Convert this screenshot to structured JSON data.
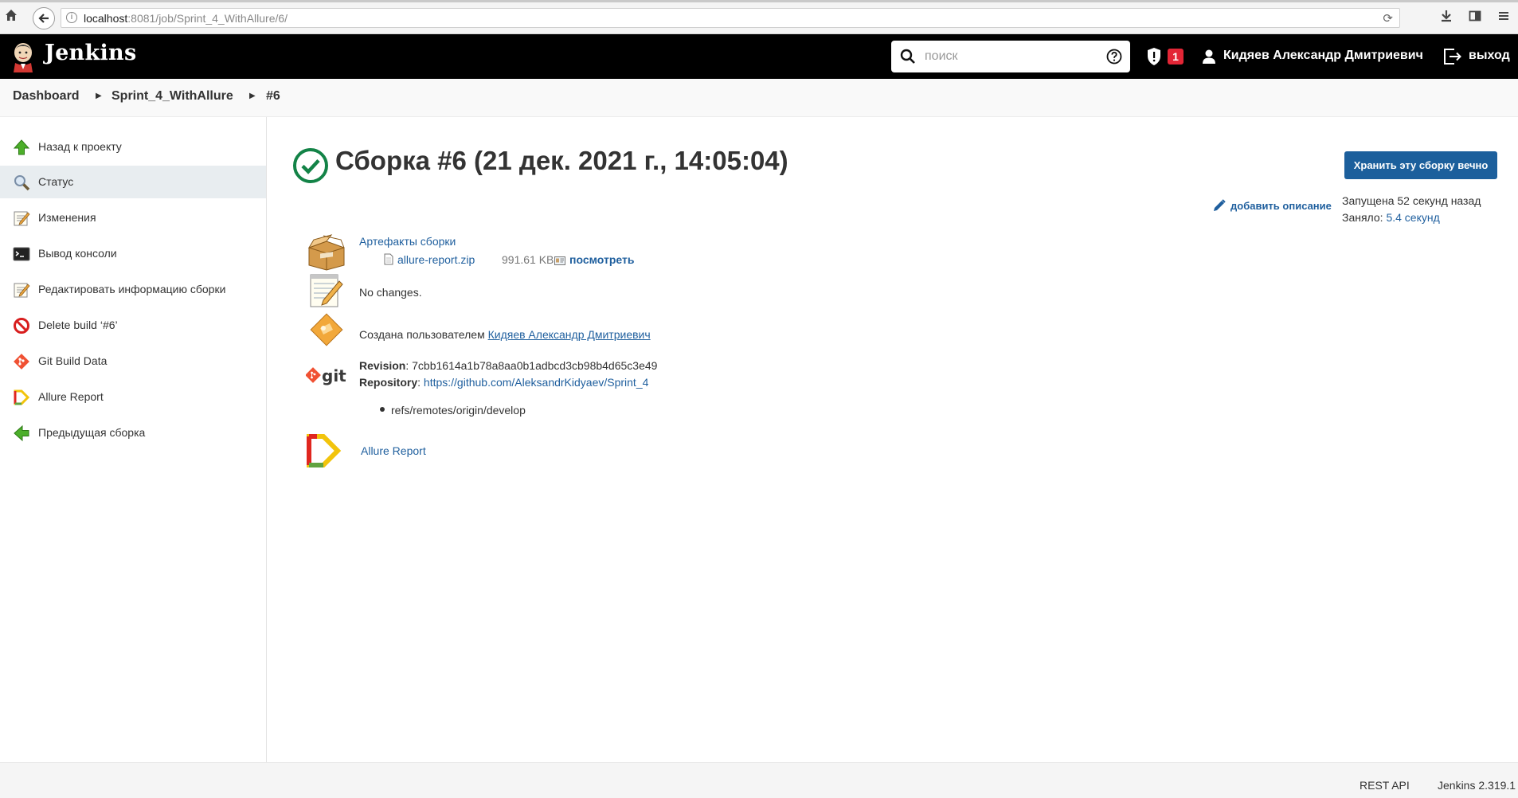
{
  "browser": {
    "url_host": "localhost",
    "url_rest": ":8081/job/Sprint_4_WithAllure/6/"
  },
  "header": {
    "brand": "Jenkins",
    "search_placeholder": "поиск",
    "security_badge": "1",
    "user_name": "Кидяев Александр Дмитриевич",
    "logout_label": "выход"
  },
  "breadcrumb": {
    "items": [
      "Dashboard",
      "Sprint_4_WithAllure",
      "#6"
    ]
  },
  "sidebar": {
    "items": [
      {
        "label": "Назад к проекту",
        "icon": "up-arrow-icon"
      },
      {
        "label": "Статус",
        "icon": "magnifier-icon"
      },
      {
        "label": "Изменения",
        "icon": "notepad-icon"
      },
      {
        "label": "Вывод консоли",
        "icon": "terminal-icon"
      },
      {
        "label": "Редактировать информацию сборки",
        "icon": "notepad-edit-icon"
      },
      {
        "label": "Delete build ‘#6’",
        "icon": "no-entry-icon"
      },
      {
        "label": "Git Build Data",
        "icon": "git-icon"
      },
      {
        "label": "Allure Report",
        "icon": "allure-icon"
      },
      {
        "label": "Предыдущая сборка",
        "icon": "left-arrow-icon"
      }
    ]
  },
  "main": {
    "title": "Сборка #6 (21 дек. 2021 г., 14:05:04)",
    "keep_button": "Хранить эту сборку вечно",
    "add_description": "добавить описание",
    "started": "Запущена 52 секунд назад",
    "took_label": "Заняло: ",
    "took_value": "5.4 секунд",
    "artifacts_title": "Артефакты сборки",
    "artifact_file": "allure-report.zip",
    "artifact_size": "991.61 KB",
    "artifact_view": "посмотреть",
    "no_changes": "No changes.",
    "created_by_prefix": "Создана пользователем ",
    "created_by_user": "Кидяев Александр Дмитриевич",
    "git_logo_text": "git",
    "revision_label": "Revision",
    "revision_value": ": 7cbb1614a1b78a8aa0b1adbcd3cb98b4d65c3e49",
    "repository_label": "Repository",
    "repository_sep": ": ",
    "repository_url": "https://github.com/AleksandrKidyaev/Sprint_4",
    "ref": "refs/remotes/origin/develop",
    "allure_report": "Allure Report"
  },
  "footer": {
    "rest_api": "REST API",
    "version": "Jenkins 2.319.1"
  },
  "colors": {
    "header_bg": "#000000",
    "link": "#1f5f9e",
    "button_bg": "#1c5f9c",
    "success": "#138347",
    "badge": "#e32636"
  }
}
